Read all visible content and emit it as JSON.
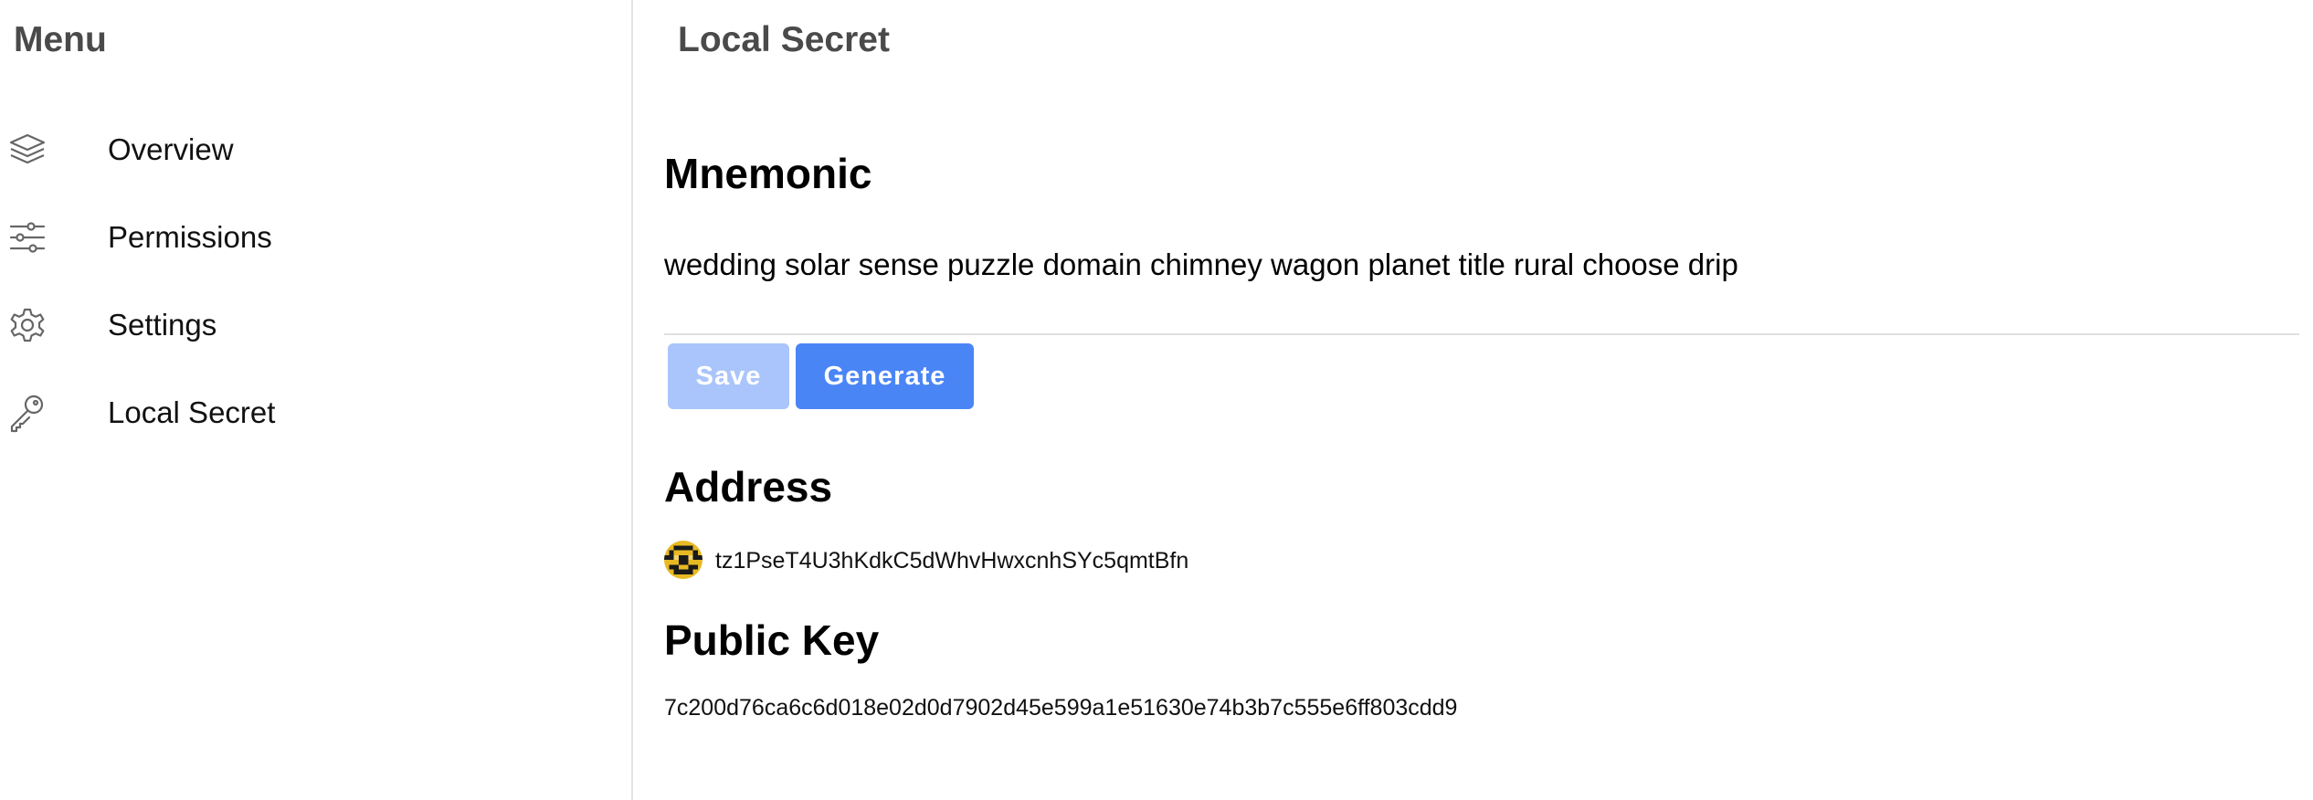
{
  "sidebar": {
    "title": "Menu",
    "items": [
      {
        "label": "Overview",
        "icon": "layers-icon"
      },
      {
        "label": "Permissions",
        "icon": "sliders-icon"
      },
      {
        "label": "Settings",
        "icon": "gear-icon"
      },
      {
        "label": "Local Secret",
        "icon": "key-icon"
      }
    ]
  },
  "main": {
    "title": "Local Secret",
    "mnemonic": {
      "heading": "Mnemonic",
      "value": "wedding solar sense puzzle domain chimney wagon planet title rural choose drip"
    },
    "buttons": {
      "save_label": "Save",
      "generate_label": "Generate"
    },
    "address": {
      "heading": "Address",
      "value": "tz1PseT4U3hKdkC5dWhvHwxcnhSYc5qmtBfn"
    },
    "public_key": {
      "heading": "Public Key",
      "value": "7c200d76ca6c6d018e02d0d7902d45e599a1e51630e74b3b7c555e6ff803cdd9"
    }
  },
  "colors": {
    "primary_button": "#4a85f6",
    "disabled_button": "#a9c5fb",
    "avatar_primary": "#e8b923",
    "avatar_secondary": "#1a1a1a"
  }
}
